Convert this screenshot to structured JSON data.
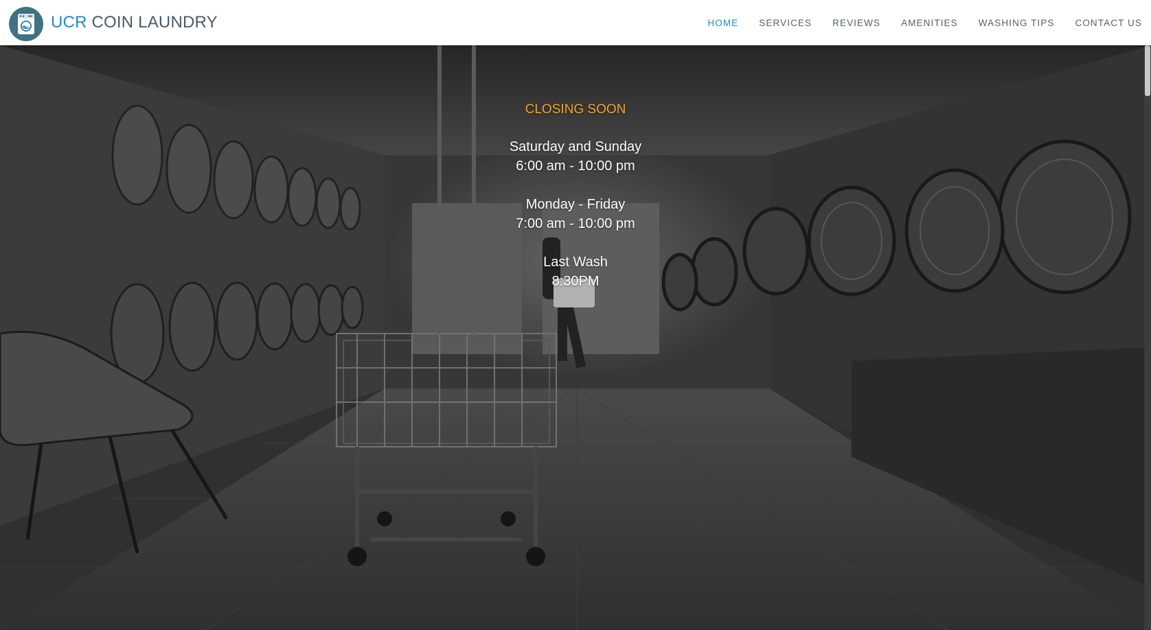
{
  "header": {
    "brand_accent": "UCR",
    "brand_rest": "COIN LAUNDRY",
    "logo_icon": "washing-machine-icon",
    "nav": [
      {
        "label": "HOME",
        "active": true
      },
      {
        "label": "SERVICES",
        "active": false
      },
      {
        "label": "REVIEWS",
        "active": false
      },
      {
        "label": "AMENITIES",
        "active": false
      },
      {
        "label": "WASHING TIPS",
        "active": false
      },
      {
        "label": "CONTACT US",
        "active": false
      }
    ]
  },
  "hero": {
    "status": "CLOSING SOON",
    "schedule": [
      {
        "days": "Saturday and Sunday",
        "hours": "6:00 am - 10:00 pm"
      },
      {
        "days": "Monday - Friday",
        "hours": "7:00 am - 10:00 pm"
      },
      {
        "days": "Last Wash",
        "hours": "8:30PM"
      }
    ]
  },
  "colors": {
    "accent": "#1e8cc6",
    "status": "#f5a623",
    "logo_bg": "#3f7282"
  }
}
